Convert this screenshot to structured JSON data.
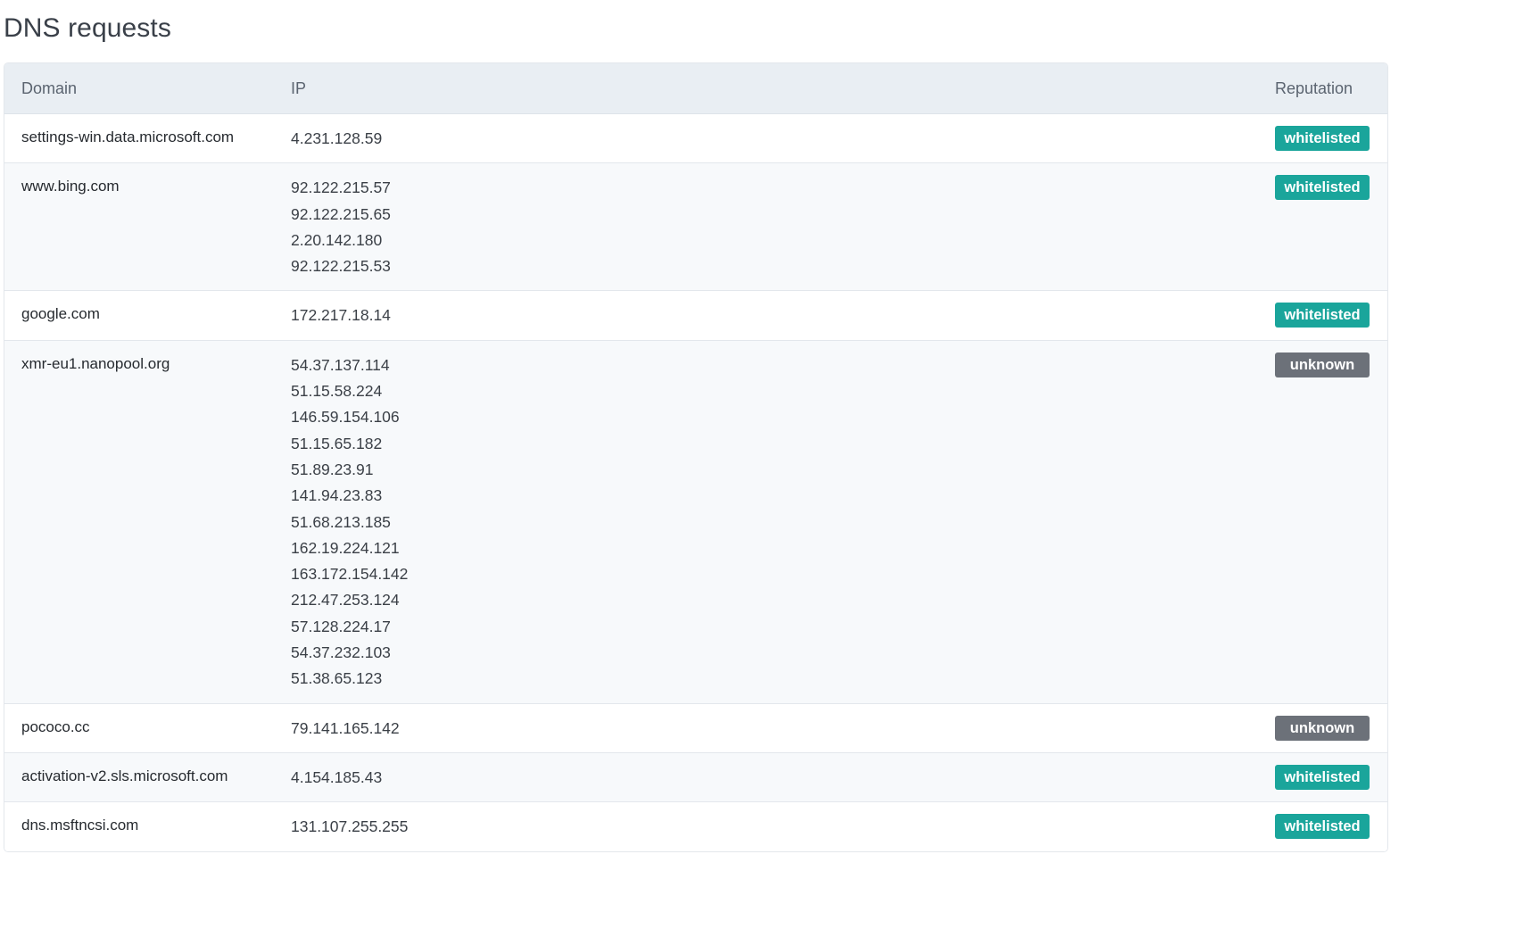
{
  "section": {
    "title": "DNS requests"
  },
  "table": {
    "headers": {
      "domain": "Domain",
      "ip": "IP",
      "reputation": "Reputation"
    },
    "rows": [
      {
        "domain": "settings-win.data.microsoft.com",
        "ips": [
          "4.231.128.59"
        ],
        "reputation": "whitelisted"
      },
      {
        "domain": "www.bing.com",
        "ips": [
          "92.122.215.57",
          "92.122.215.65",
          "2.20.142.180",
          "92.122.215.53"
        ],
        "reputation": "whitelisted"
      },
      {
        "domain": "google.com",
        "ips": [
          "172.217.18.14"
        ],
        "reputation": "whitelisted"
      },
      {
        "domain": "xmr-eu1.nanopool.org",
        "ips": [
          "54.37.137.114",
          "51.15.58.224",
          "146.59.154.106",
          "51.15.65.182",
          "51.89.23.91",
          "141.94.23.83",
          "51.68.213.185",
          "162.19.224.121",
          "163.172.154.142",
          "212.47.253.124",
          "57.128.224.17",
          "54.37.232.103",
          "51.38.65.123"
        ],
        "reputation": "unknown"
      },
      {
        "domain": "pococo.cc",
        "ips": [
          "79.141.165.142"
        ],
        "reputation": "unknown"
      },
      {
        "domain": "activation-v2.sls.microsoft.com",
        "ips": [
          "4.154.185.43"
        ],
        "reputation": "whitelisted"
      },
      {
        "domain": "dns.msftncsi.com",
        "ips": [
          "131.107.255.255"
        ],
        "reputation": "whitelisted"
      }
    ]
  },
  "colors": {
    "whitelisted": "#1aa59b",
    "unknown": "#6c7179",
    "header_bg": "#e9eef3"
  }
}
